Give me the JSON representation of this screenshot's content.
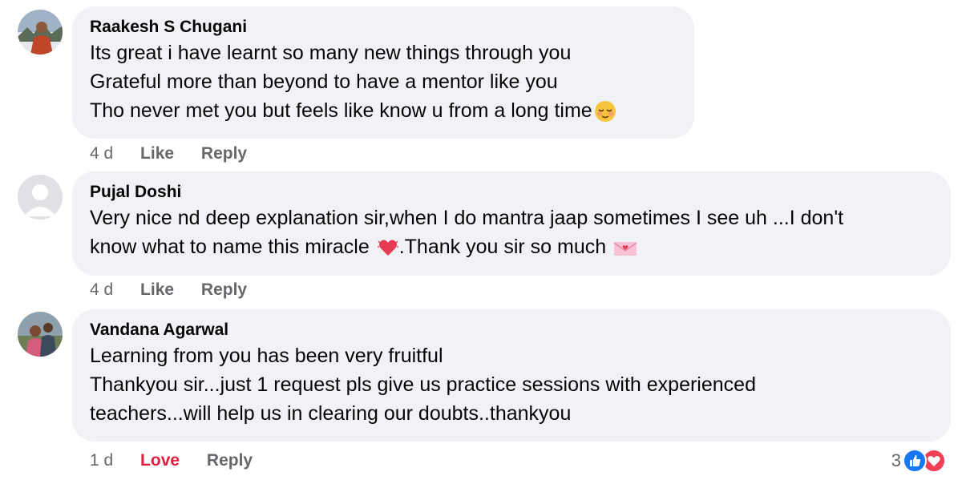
{
  "comments": [
    {
      "author": "Raakesh S Chugani",
      "lines": [
        "Its great i have learnt so many new things through you",
        "Grateful more than beyond to have a mentor like you",
        "Tho never met you but feels like know u from a long time"
      ],
      "time": "4 d",
      "like_label": "Like",
      "reply_label": "Reply"
    },
    {
      "author": "Pujal Doshi",
      "lines": [
        "Very nice nd deep explanation sir,when I do mantra jaap sometimes I see uh ...I don't",
        "know what to name this miracle",
        ".Thank you sir so much"
      ],
      "time": "4 d",
      "like_label": "Like",
      "reply_label": "Reply"
    },
    {
      "author": "Vandana Agarwal",
      "lines": [
        "Learning from you has been very fruitful",
        "Thankyou sir...just 1 request pls give us practice sessions with experienced",
        "teachers...will help us in clearing our doubts..thankyou"
      ],
      "time": "1 d",
      "like_label": "Love",
      "reply_label": "Reply",
      "reaction_count": "3"
    }
  ],
  "colors": {
    "bubble": "#f0f2f5",
    "meta": "#65676b",
    "love": "#e41e3f",
    "like_icon": "#1877f2",
    "heart_icon": "#f33e58"
  }
}
